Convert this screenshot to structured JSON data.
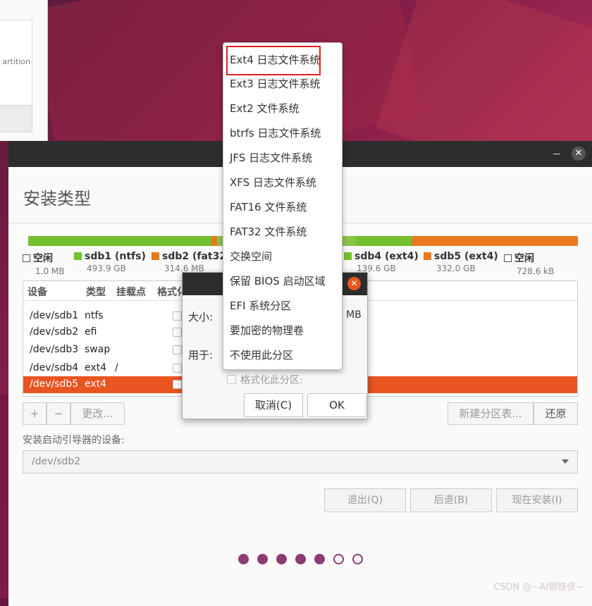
{
  "window": {
    "heading": "安装类型",
    "close_glyph": "✕"
  },
  "background_window": {
    "partial_text": "artition"
  },
  "partition_bar": [
    {
      "name": "空闲",
      "size": "1.0 MB",
      "color": "#ffffff",
      "fraction": 0.01
    },
    {
      "name": "sdb1 (ntfs)",
      "size": "493.9 GB",
      "color": "#73c12d",
      "fraction": 0.33
    },
    {
      "name": "sdb2 (fat32)",
      "size": "314.6 MB",
      "color": "#e8791e",
      "fraction": 0.01
    },
    {
      "name": "sdb3",
      "size": "",
      "color": "#8bc34a",
      "fraction": 0.25
    },
    {
      "name": "sdb4 (ext4)",
      "size": "139.6 GB",
      "color": "#73c12d",
      "fraction": 0.1
    },
    {
      "name": "sdb5 (ext4)",
      "size": "332.0 GB",
      "color": "#e8791e",
      "fraction": 0.3
    }
  ],
  "legend": [
    {
      "name": "空闲",
      "size": "1.0 MB",
      "color": "#ffffff"
    },
    {
      "name": "sdb1 (ntfs)",
      "size": "493.9 GB",
      "color": "#73c12d"
    },
    {
      "name": "sdb2 (fat32)",
      "size": "314.6 MB",
      "color": "#e8791e"
    },
    {
      "name": "sdb4 (ext4)",
      "size": "139.6 GB",
      "color": "#73c12d"
    },
    {
      "name": "sdb5 (ext4)",
      "size": "332.0 GB",
      "color": "#e8791e"
    },
    {
      "name": "空闲",
      "size": "728.6 kB",
      "color": "#ffffff"
    }
  ],
  "table": {
    "headers": [
      "设备",
      "类型",
      "挂载点",
      "格式化"
    ],
    "rows": [
      {
        "device": "/dev/sdb1",
        "type": "ntfs",
        "mount": ""
      },
      {
        "device": "/dev/sdb2",
        "type": "efi",
        "mount": ""
      },
      {
        "device": "/dev/sdb3",
        "type": "swap",
        "mount": ""
      },
      {
        "device": "/dev/sdb4",
        "type": "ext4",
        "mount": "/"
      },
      {
        "device": "/dev/sdb5",
        "type": "ext4",
        "mount": ""
      }
    ]
  },
  "toolbar": {
    "add": "+",
    "remove": "−",
    "change": "更改...",
    "new_table": "新建分区表...",
    "revert": "还原"
  },
  "boot_loader": {
    "label": "安装启动引导器的设备:",
    "value": "/dev/sdb2"
  },
  "bottom_buttons": {
    "quit": "退出(Q)",
    "back": "后退(B)",
    "install": "现在安装(I)"
  },
  "progress": {
    "current_step": 5,
    "total_steps": 7
  },
  "dialog": {
    "size_label": "大小:",
    "size_unit": "MB",
    "use_as_label": "用于:",
    "format_label": "格式化此分区:",
    "cancel": "取消(C)",
    "ok": "OK",
    "close_glyph": "✕"
  },
  "menu": {
    "items": [
      "Ext4 日志文件系统",
      "Ext3 日志文件系统",
      "Ext2 文件系统",
      "btrfs 日志文件系统",
      "JFS 日志文件系统",
      "XFS 日志文件系统",
      "FAT16 文件系统",
      "FAT32 文件系统",
      "交换空间",
      "保留 BIOS 启动区域",
      "EFI 系统分区",
      "要加密的物理卷",
      "不使用此分区"
    ],
    "highlight_color": "#e02020"
  },
  "watermark": "CSDN @~AI钢铁侠~"
}
